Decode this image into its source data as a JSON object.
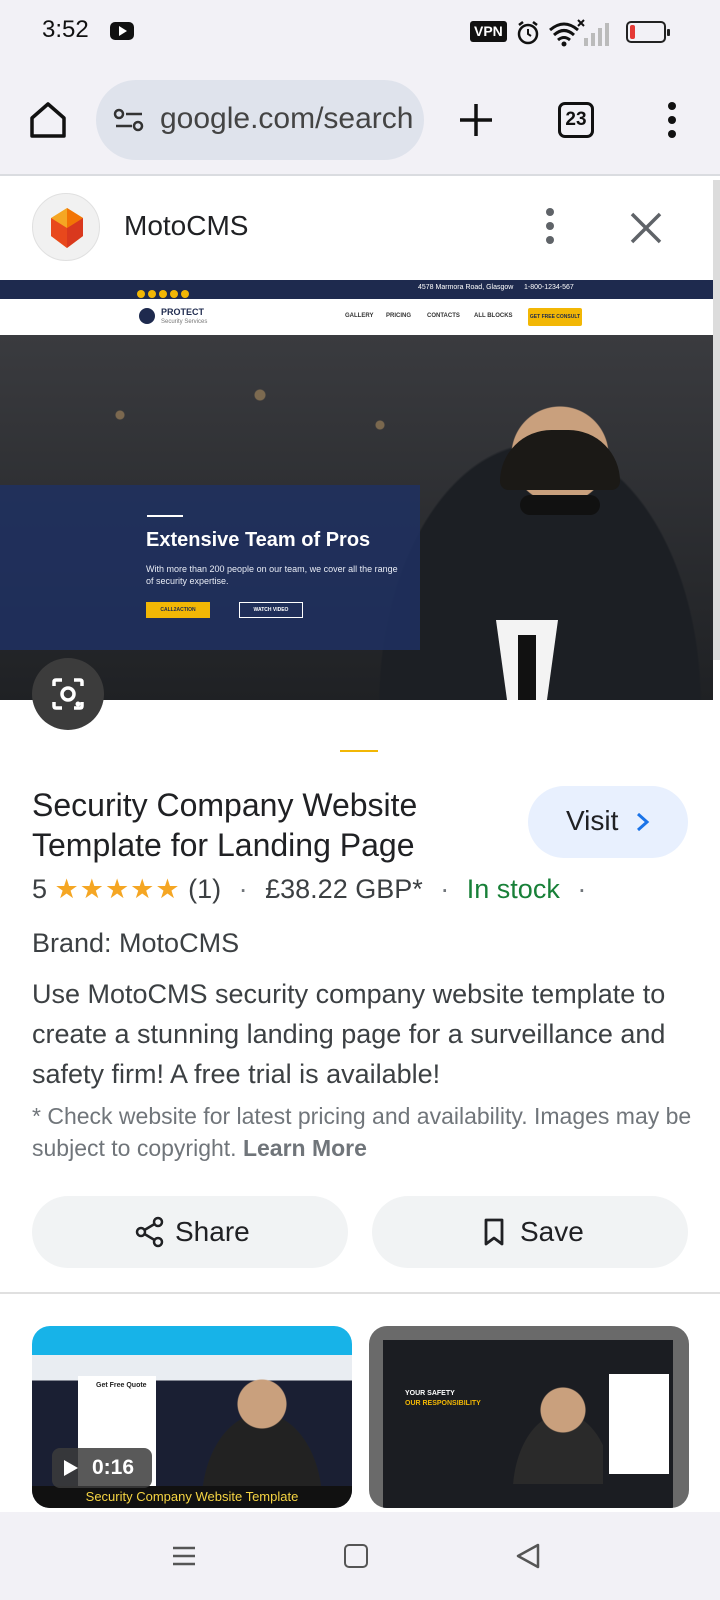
{
  "status_bar": {
    "time": "3:52",
    "vpn_label": "VPN",
    "battery_level": 0.15
  },
  "browser": {
    "url": "google.com/search",
    "tab_count": "23",
    "icons": [
      "home-icon",
      "site-settings-icon",
      "new-tab-plus-icon",
      "tab-switcher-icon",
      "overflow-menu-icon"
    ]
  },
  "sheet": {
    "site_name": "MotoCMS",
    "icons": [
      "motocms-logo-icon",
      "more-options-icon",
      "close-icon"
    ]
  },
  "hero": {
    "topbar_address": "4578 Marmora Road, Glasgow",
    "topbar_phone": "1-800-1234-567",
    "brand": "PROTECT",
    "brand_sub": "Security Services",
    "nav_items": [
      "GALLERY",
      "PRICING",
      "CONTACTS",
      "ALL BLOCKS"
    ],
    "cta": "GET FREE CONSULT",
    "panel_title": "Extensive Team of Pros",
    "panel_desc": "With more than 200 people on our team, we cover all the range of security expertise.",
    "panel_btn1": "CALL2ACTION",
    "panel_btn2": "WATCH VIDEO",
    "accent": "#f2b705",
    "panel_color": "#1f3061"
  },
  "product": {
    "title": "Security Company Website Template for Landing Page",
    "visit_label": "Visit",
    "rating": "5",
    "stars": "★★★★★",
    "reviews": "(1)",
    "price": "£38.22 GBP*",
    "stock": "In stock",
    "brand_line": "Brand: MotoCMS",
    "description": "Use MotoCMS security company website template to create a stunning landing page for a surveillance and safety firm! A free trial is available!",
    "disclaimer": "* Check website for latest pricing and availability. Images may be subject to copyright.",
    "learn_more": "Learn More",
    "stock_color": "#188038",
    "star_color": "#f5a623"
  },
  "actions": {
    "share_label": "Share",
    "save_label": "Save"
  },
  "thumbnails": {
    "left_caption": "Security Company  Website Template",
    "left_quote_title": "Get Free Quote",
    "duration": "0:16",
    "right_headline": "YOUR SAFETY",
    "right_headline2": "OUR RESPONSIBILITY"
  }
}
